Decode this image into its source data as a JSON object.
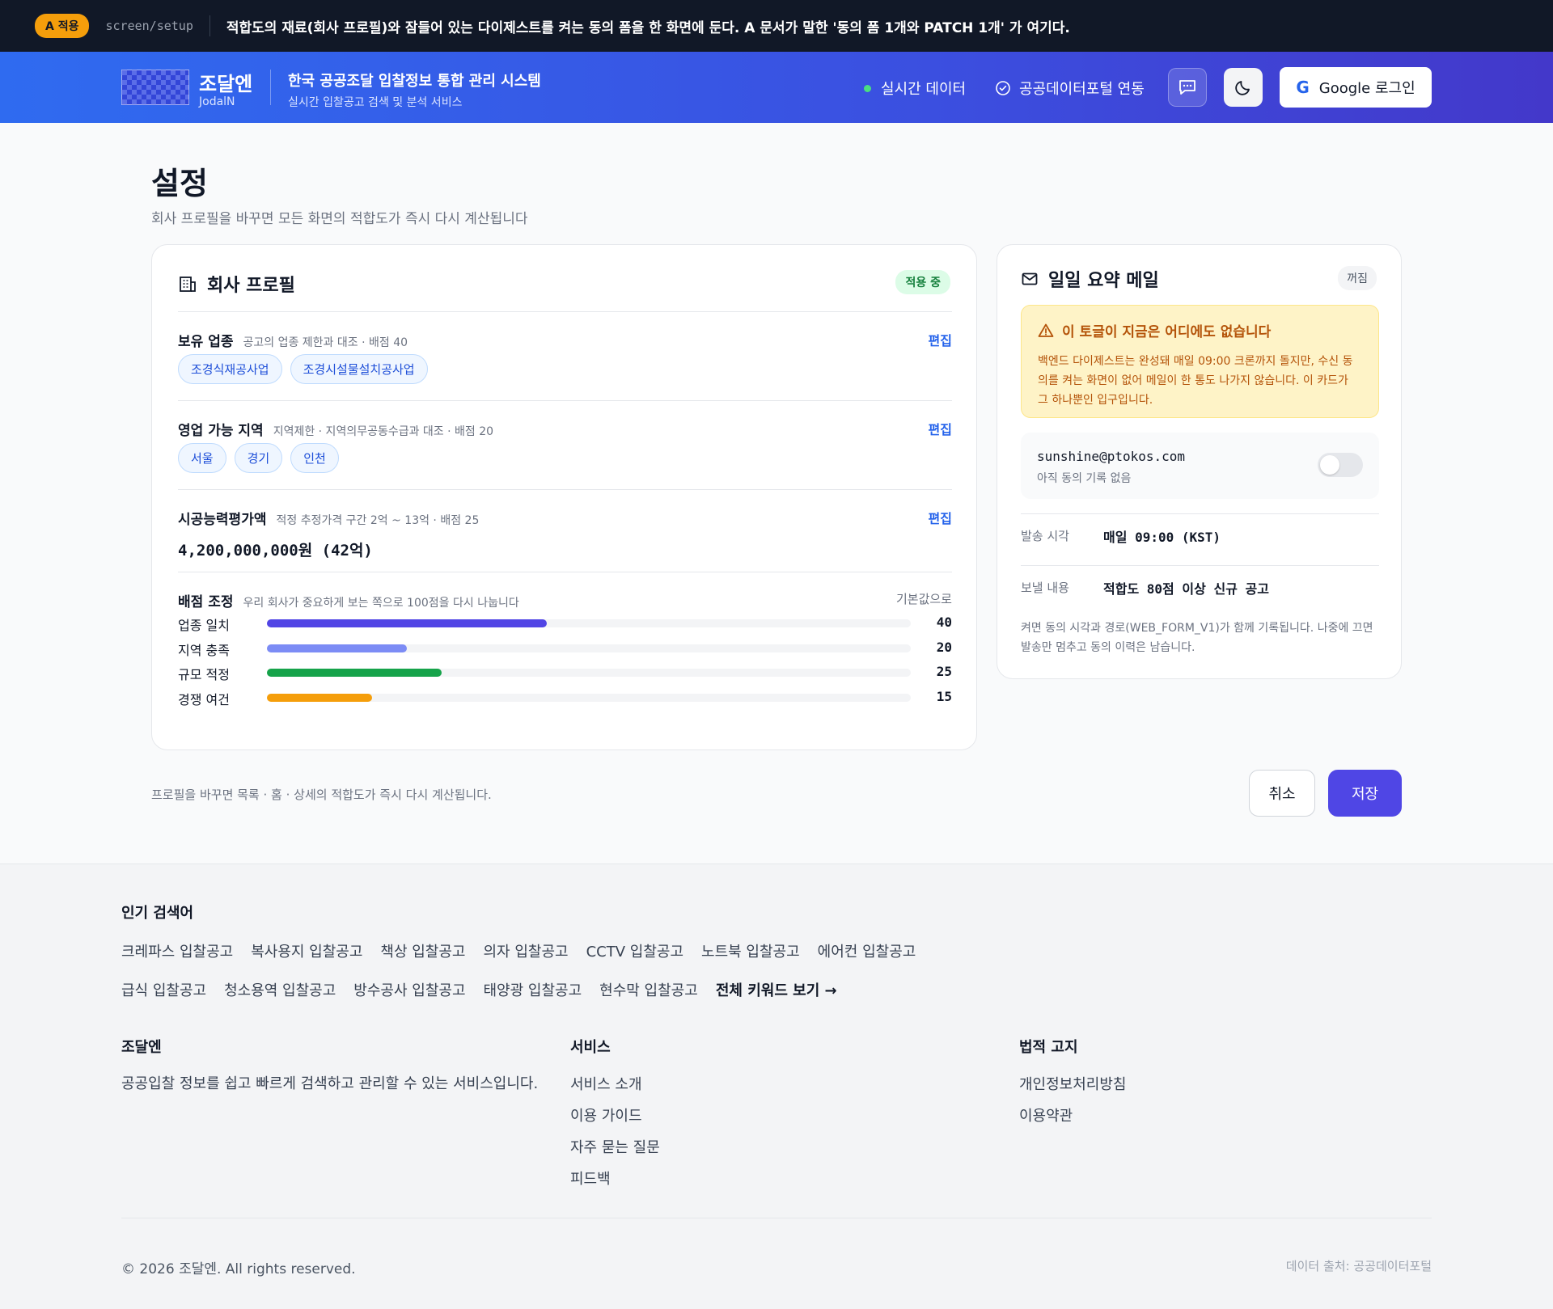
{
  "strip": {
    "badge": "A 적용",
    "path": "screen/setup",
    "note": "적합도의 재료(회사 프로필)와 잠들어 있는 다이제스트를 켜는 동의 폼을 한 화면에 둔다. A 문서가 말한 '동의 폼 1개와 PATCH 1개' 가 여기다."
  },
  "header": {
    "brand_name": "조달엔",
    "brand_sub": "JodalN",
    "system_title": "한국 공공조달 입찰정보 통합 관리 시스템",
    "system_sub": "실시간 입찰공고 검색 및 분석 서비스",
    "live_label": "실시간 데이터",
    "portal_label": "공공데이터포털 연동",
    "login_label": "Google 로그인",
    "live_dot_color": "#4ade80"
  },
  "page": {
    "title": "설정",
    "subtitle": "회사 프로필을 바꾸면 모든 화면의 적합도가 즉시 다시 계산됩니다"
  },
  "profile": {
    "title": "회사 프로필",
    "status": "적용 중",
    "industry": {
      "label": "보유 업종",
      "hint": "공고의 업종 제한과 대조 · 배점 40",
      "edit": "편집",
      "chips": [
        "조경식재공사업",
        "조경시설물설치공사업"
      ]
    },
    "region": {
      "label": "영업 가능 지역",
      "hint": "지역제한 · 지역의무공동수급과 대조 · 배점 20",
      "edit": "편집",
      "chips": [
        "서울",
        "경기",
        "인천"
      ]
    },
    "capacity": {
      "label": "시공능력평가액",
      "hint": "적정 추정가격 구간 2억 ~ 13억 · 배점 25",
      "edit": "편집",
      "value": "4,200,000,000원 (42억)"
    },
    "weights": {
      "label": "배점 조정",
      "hint": "우리 회사가 중요하게 보는 쪽으로 100점을 다시 나눕니다",
      "reset": "기본값으로",
      "items": [
        {
          "label": "업종 일치",
          "value": 40,
          "color": "#5145e5"
        },
        {
          "label": "지역 충족",
          "value": 20,
          "color": "#7c8cf5"
        },
        {
          "label": "규모 적정",
          "value": 25,
          "color": "#16a34a"
        },
        {
          "label": "경쟁 여건",
          "value": 15,
          "color": "#f59e0b"
        }
      ]
    }
  },
  "mail": {
    "title": "일일 요약 메일",
    "status": "꺼짐",
    "warn_title": "이 토글이 지금은 어디에도 없습니다",
    "warn_body": "백엔드 다이제스트는 완성돼 매일 09:00 크론까지 돌지만, 수신 동의를 켜는 화면이 없어 메일이 한 통도 나가지 않습니다. 이 카드가 그 하나뿐인 입구입니다.",
    "address": "sunshine@ptokos.com",
    "consent_state": "아직 동의 기록 없음",
    "send_time_label": "발송 시각",
    "send_time_value": "매일 09:00 (KST)",
    "content_label": "보낼 내용",
    "content_value": "적합도 80점 이상 신규 공고",
    "footnote": "켜면 동의 시각과 경로(WEB_FORM_V1)가 함께 기록됩니다. 나중에 끄면 발송만 멈추고 동의 이력은 남습니다."
  },
  "actions": {
    "note": "프로필을 바꾸면 목록 · 홈 · 상세의 적합도가 즉시 다시 계산됩니다.",
    "cancel": "취소",
    "save": "저장"
  },
  "footer": {
    "popular_title": "인기 검색어",
    "keywords_row1": [
      "크레파스 입찰공고",
      "복사용지 입찰공고",
      "책상 입찰공고",
      "의자 입찰공고",
      "CCTV 입찰공고",
      "노트북 입찰공고",
      "에어컨 입찰공고"
    ],
    "keywords_row2": [
      "급식 입찰공고",
      "청소용역 입찰공고",
      "방수공사 입찰공고",
      "태양광 입찰공고",
      "현수막 입찰공고"
    ],
    "all_keywords": "전체 키워드 보기 →",
    "about_title": "조달엔",
    "about_text": "공공입찰 정보를 쉽고 빠르게 검색하고 관리할 수 있는 서비스입니다.",
    "service_title": "서비스",
    "service_links": [
      "서비스 소개",
      "이용 가이드",
      "자주 묻는 질문",
      "피드백"
    ],
    "legal_title": "법적 고지",
    "legal_links": [
      "개인정보처리방침",
      "이용약관"
    ],
    "copyright": "© 2026 조달엔. All rights reserved.",
    "source": "데이터 출처: 공공데이터포털"
  }
}
